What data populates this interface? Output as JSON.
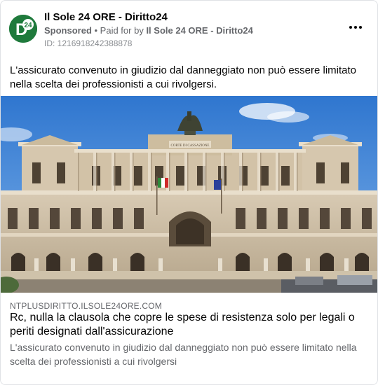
{
  "post": {
    "page_name": "Il Sole 24 ORE - Diritto24",
    "avatar_text": "24",
    "sponsored_label": "Sponsored",
    "paid_prefix": " • Paid for by ",
    "paid_by": "Il Sole 24 ORE - Diritto24",
    "ad_id": "ID: 1216918242388878",
    "more_icon": "more-horizontal-icon",
    "body_text": "L'assicurato convenuto in giudizio dal danneggiato non può essere limitato nella scelta dei professionisti a cui rivolgersi."
  },
  "link_preview": {
    "domain": "NTPLUSDIRITTO.ILSOLE24ORE.COM",
    "headline": "Rc, nulla la clausola che copre le spese di resistenza solo per legali o periti designati dall'assicurazione",
    "description": "L'assicurato convenuto in giudizio dal danneggiato non può essere limitato nella scelta dei professionisti a cui rivolgersi",
    "image_sign_text": "CORTE DI CASSAZIONE"
  },
  "colors": {
    "brand_green": "#1f7a3c",
    "secondary_text": "#65676b",
    "sky": "#3f86d8"
  }
}
